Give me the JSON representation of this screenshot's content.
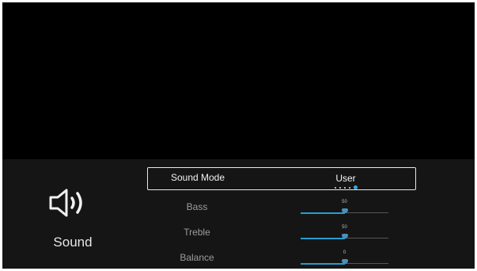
{
  "category": {
    "label": "Sound",
    "icon": "speaker-volume-icon"
  },
  "sound_mode": {
    "label": "Sound Mode",
    "value": "User",
    "option_count": 5,
    "selected_index": 4
  },
  "sliders": [
    {
      "id": "bass",
      "label": "Bass",
      "value": "50",
      "level": 0.5
    },
    {
      "id": "treble",
      "label": "Treble",
      "value": "50",
      "level": 0.5
    },
    {
      "id": "balance",
      "label": "Balance",
      "value": "0",
      "level": 0.5
    }
  ],
  "colors": {
    "accent": "#2a9bd0",
    "background": "#000000",
    "panel": "#151515"
  }
}
